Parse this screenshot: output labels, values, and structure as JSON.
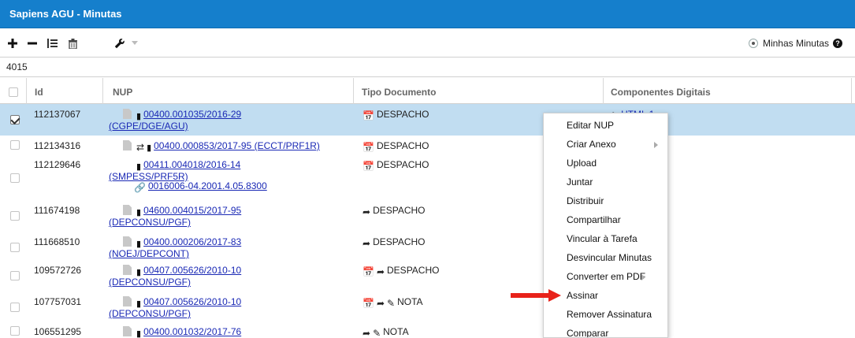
{
  "window": {
    "title": "Sapiens AGU - Minutas"
  },
  "toolbar": {
    "add_icon": "plus-icon",
    "remove_icon": "minus-icon",
    "list_icon": "list-icon",
    "delete_icon": "trash-icon",
    "tools_icon": "wrench-icon",
    "radio_label": "Minhas Minutas"
  },
  "search": {
    "value": "4015"
  },
  "columns": {
    "id": "Id",
    "nup": "NUP",
    "tipo": "Tipo Documento",
    "comp": "Componentes Digitais"
  },
  "rows": [
    {
      "id": "112137067",
      "nup1": "00400.001035/2016-29",
      "nup2": "(CGPE/DGE/AGU)",
      "tipo": "DESPACHO",
      "comp": "HTML 1",
      "selected": true
    },
    {
      "id": "112134316",
      "nup1": "00400.000853/2017-95 (ECCT/PRF1R)",
      "nup2": "",
      "tipo": "DESPACHO"
    },
    {
      "id": "112129646",
      "nup1": "00411.004018/2016-14",
      "nup2": "(SMPESS/PRF5R)",
      "nup3": "0016006-04.2001.4.05.8300",
      "tipo": "DESPACHO"
    },
    {
      "id": "111674198",
      "nup1": "04600.004015/2017-95",
      "nup2": "(DEPCONSU/PGF)",
      "tipo": "DESPACHO"
    },
    {
      "id": "111668510",
      "nup1": "00400.000206/2017-83",
      "nup2": "(NOEJ/DEPCONT)",
      "tipo": "DESPACHO"
    },
    {
      "id": "109572726",
      "nup1": "00407.005626/2010-10",
      "nup2": "(DEPCONSU/PGF)",
      "tipo": "DESPACHO"
    },
    {
      "id": "107757031",
      "nup1": "00407.005626/2010-10",
      "nup2": "(DEPCONSU/PGF)",
      "tipo": "NOTA"
    },
    {
      "id": "106551295",
      "nup1": "00400.001032/2017-76",
      "nup2": "",
      "tipo": "NOTA"
    }
  ],
  "context_menu": {
    "items": [
      {
        "label": "Editar NUP"
      },
      {
        "label": "Criar Anexo",
        "submenu": true
      },
      {
        "label": "Upload"
      },
      {
        "label": "Juntar"
      },
      {
        "label": "Distribuir"
      },
      {
        "label": "Compartilhar"
      },
      {
        "label": "Vincular à Tarefa"
      },
      {
        "label": "Desvincular Minutas"
      },
      {
        "label": "Converter em PDF",
        "submenu": true
      },
      {
        "label": "Assinar"
      },
      {
        "label": "Remover Assinatura"
      },
      {
        "label": "Comparar"
      }
    ]
  },
  "colors": {
    "header_blue": "#157fcc",
    "selected_row": "#c1ddf1",
    "link": "#1a29b5",
    "annotation_arrow": "#e8221a"
  }
}
